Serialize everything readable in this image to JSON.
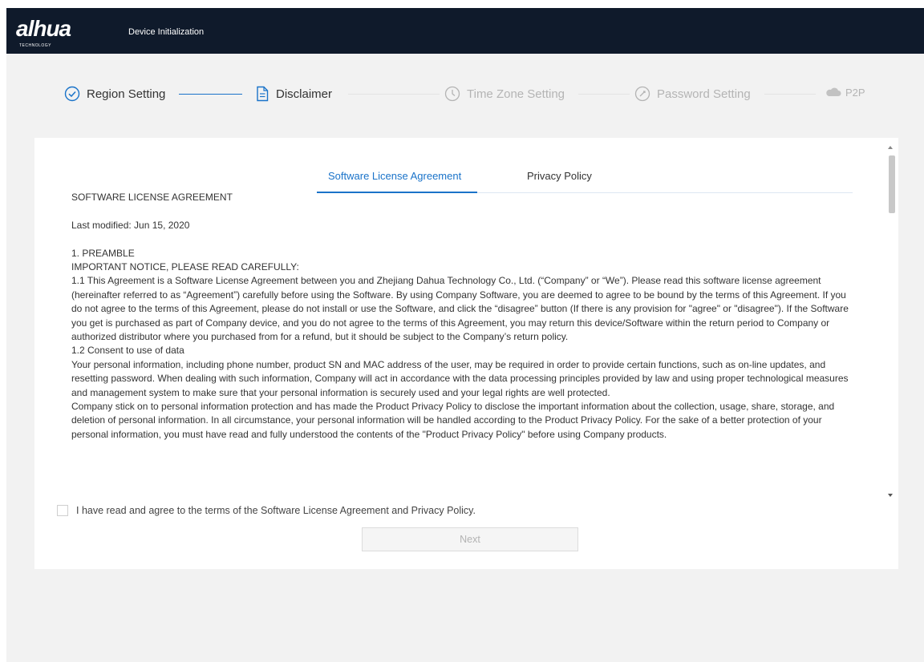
{
  "header": {
    "logo_text": "alhua",
    "logo_subtext": "TECHNOLOGY",
    "title": "Device Initialization"
  },
  "steps": [
    {
      "label": "Region Setting",
      "state": "done",
      "icon": "check-circle-icon"
    },
    {
      "label": "Disclaimer",
      "state": "active",
      "icon": "document-icon"
    },
    {
      "label": "Time Zone Setting",
      "state": "pending",
      "icon": "clock-icon"
    },
    {
      "label": "Password Setting",
      "state": "pending",
      "icon": "lock-icon"
    },
    {
      "label": "P2P",
      "state": "pending",
      "icon": "cloud-icon"
    }
  ],
  "tabs": {
    "active": "Software License Agreement",
    "inactive": "Privacy Policy"
  },
  "agreement": {
    "heading": "SOFTWARE LICENSE AGREEMENT",
    "modified": "Last modified: Jun 15, 2020",
    "section1": "1. PREAMBLE",
    "notice": "IMPORTANT NOTICE, PLEASE READ CAREFULLY:",
    "p1_1": "1.1 This Agreement is a Software License Agreement between you and Zhejiang Dahua Technology Co., Ltd. (“Company” or “We”). Please read this software license agreement (hereinafter referred to as “Agreement”) carefully before using the Software. By using Company Software, you are deemed to agree to be bound by the terms of this Agreement. If you do not agree to the terms of this Agreement, please do not install or use the Software, and click the “disagree” button (If there is any provision for \"agree\" or \"disagree\"). If the Software you get is purchased as part of Company device, and you do not agree to the terms of this Agreement, you may return this device/Software within the return period to Company or authorized distributor where you purchased from for a refund, but it should be subject to the Company’s return policy.",
    "p1_2_title": "1.2 Consent to use of data",
    "p1_2": "Your personal information, including phone number, product SN and MAC address of the user, may be required in order to provide certain functions, such as on-line updates, and resetting password. When dealing with such information, Company will act in accordance with the data processing principles provided by law and using proper technological measures and management system to make sure that your personal information is securely used and your legal rights are well protected.",
    "p1_3": "Company stick on to personal information protection and has made the Product Privacy Policy to disclose the important information about the collection, usage, share, storage, and deletion of personal information. In all circumstance, your personal information will be handled according to the Product Privacy Policy. For the sake of a better protection of your personal information, you must have read and fully understood the contents of the \"Product Privacy Policy\" before using Company products."
  },
  "agree_label": "I have read and agree to the terms of the Software License Agreement and Privacy Policy.",
  "next_label": "Next",
  "colors": {
    "topbar": "#0f1a2b",
    "accent": "#1a73c9",
    "pending": "#b4b4b4"
  }
}
